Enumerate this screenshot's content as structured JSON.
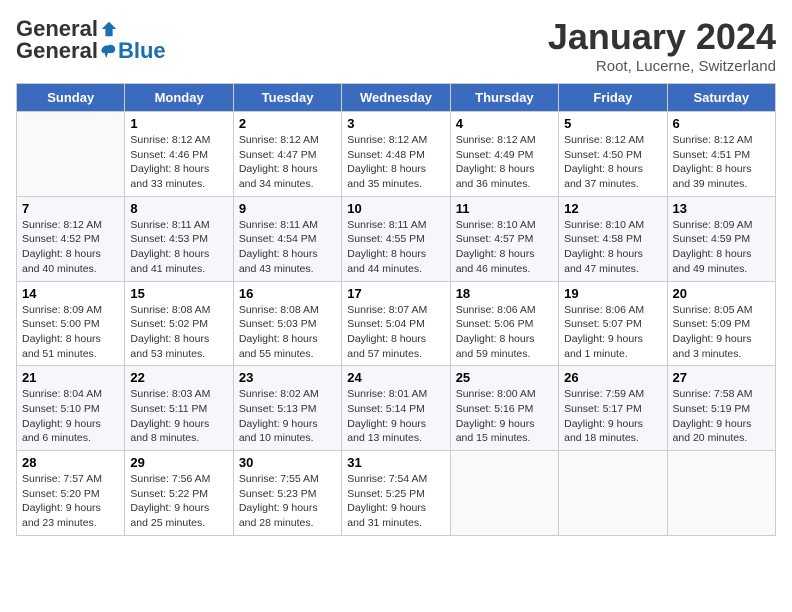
{
  "header": {
    "logo_general": "General",
    "logo_blue": "Blue",
    "title": "January 2024",
    "subtitle": "Root, Lucerne, Switzerland"
  },
  "days_of_week": [
    "Sunday",
    "Monday",
    "Tuesday",
    "Wednesday",
    "Thursday",
    "Friday",
    "Saturday"
  ],
  "weeks": [
    [
      {
        "num": "",
        "empty": true
      },
      {
        "num": "1",
        "sunrise": "Sunrise: 8:12 AM",
        "sunset": "Sunset: 4:46 PM",
        "daylight": "Daylight: 8 hours and 33 minutes."
      },
      {
        "num": "2",
        "sunrise": "Sunrise: 8:12 AM",
        "sunset": "Sunset: 4:47 PM",
        "daylight": "Daylight: 8 hours and 34 minutes."
      },
      {
        "num": "3",
        "sunrise": "Sunrise: 8:12 AM",
        "sunset": "Sunset: 4:48 PM",
        "daylight": "Daylight: 8 hours and 35 minutes."
      },
      {
        "num": "4",
        "sunrise": "Sunrise: 8:12 AM",
        "sunset": "Sunset: 4:49 PM",
        "daylight": "Daylight: 8 hours and 36 minutes."
      },
      {
        "num": "5",
        "sunrise": "Sunrise: 8:12 AM",
        "sunset": "Sunset: 4:50 PM",
        "daylight": "Daylight: 8 hours and 37 minutes."
      },
      {
        "num": "6",
        "sunrise": "Sunrise: 8:12 AM",
        "sunset": "Sunset: 4:51 PM",
        "daylight": "Daylight: 8 hours and 39 minutes."
      }
    ],
    [
      {
        "num": "7",
        "sunrise": "Sunrise: 8:12 AM",
        "sunset": "Sunset: 4:52 PM",
        "daylight": "Daylight: 8 hours and 40 minutes."
      },
      {
        "num": "8",
        "sunrise": "Sunrise: 8:11 AM",
        "sunset": "Sunset: 4:53 PM",
        "daylight": "Daylight: 8 hours and 41 minutes."
      },
      {
        "num": "9",
        "sunrise": "Sunrise: 8:11 AM",
        "sunset": "Sunset: 4:54 PM",
        "daylight": "Daylight: 8 hours and 43 minutes."
      },
      {
        "num": "10",
        "sunrise": "Sunrise: 8:11 AM",
        "sunset": "Sunset: 4:55 PM",
        "daylight": "Daylight: 8 hours and 44 minutes."
      },
      {
        "num": "11",
        "sunrise": "Sunrise: 8:10 AM",
        "sunset": "Sunset: 4:57 PM",
        "daylight": "Daylight: 8 hours and 46 minutes."
      },
      {
        "num": "12",
        "sunrise": "Sunrise: 8:10 AM",
        "sunset": "Sunset: 4:58 PM",
        "daylight": "Daylight: 8 hours and 47 minutes."
      },
      {
        "num": "13",
        "sunrise": "Sunrise: 8:09 AM",
        "sunset": "Sunset: 4:59 PM",
        "daylight": "Daylight: 8 hours and 49 minutes."
      }
    ],
    [
      {
        "num": "14",
        "sunrise": "Sunrise: 8:09 AM",
        "sunset": "Sunset: 5:00 PM",
        "daylight": "Daylight: 8 hours and 51 minutes."
      },
      {
        "num": "15",
        "sunrise": "Sunrise: 8:08 AM",
        "sunset": "Sunset: 5:02 PM",
        "daylight": "Daylight: 8 hours and 53 minutes."
      },
      {
        "num": "16",
        "sunrise": "Sunrise: 8:08 AM",
        "sunset": "Sunset: 5:03 PM",
        "daylight": "Daylight: 8 hours and 55 minutes."
      },
      {
        "num": "17",
        "sunrise": "Sunrise: 8:07 AM",
        "sunset": "Sunset: 5:04 PM",
        "daylight": "Daylight: 8 hours and 57 minutes."
      },
      {
        "num": "18",
        "sunrise": "Sunrise: 8:06 AM",
        "sunset": "Sunset: 5:06 PM",
        "daylight": "Daylight: 8 hours and 59 minutes."
      },
      {
        "num": "19",
        "sunrise": "Sunrise: 8:06 AM",
        "sunset": "Sunset: 5:07 PM",
        "daylight": "Daylight: 9 hours and 1 minute."
      },
      {
        "num": "20",
        "sunrise": "Sunrise: 8:05 AM",
        "sunset": "Sunset: 5:09 PM",
        "daylight": "Daylight: 9 hours and 3 minutes."
      }
    ],
    [
      {
        "num": "21",
        "sunrise": "Sunrise: 8:04 AM",
        "sunset": "Sunset: 5:10 PM",
        "daylight": "Daylight: 9 hours and 6 minutes."
      },
      {
        "num": "22",
        "sunrise": "Sunrise: 8:03 AM",
        "sunset": "Sunset: 5:11 PM",
        "daylight": "Daylight: 9 hours and 8 minutes."
      },
      {
        "num": "23",
        "sunrise": "Sunrise: 8:02 AM",
        "sunset": "Sunset: 5:13 PM",
        "daylight": "Daylight: 9 hours and 10 minutes."
      },
      {
        "num": "24",
        "sunrise": "Sunrise: 8:01 AM",
        "sunset": "Sunset: 5:14 PM",
        "daylight": "Daylight: 9 hours and 13 minutes."
      },
      {
        "num": "25",
        "sunrise": "Sunrise: 8:00 AM",
        "sunset": "Sunset: 5:16 PM",
        "daylight": "Daylight: 9 hours and 15 minutes."
      },
      {
        "num": "26",
        "sunrise": "Sunrise: 7:59 AM",
        "sunset": "Sunset: 5:17 PM",
        "daylight": "Daylight: 9 hours and 18 minutes."
      },
      {
        "num": "27",
        "sunrise": "Sunrise: 7:58 AM",
        "sunset": "Sunset: 5:19 PM",
        "daylight": "Daylight: 9 hours and 20 minutes."
      }
    ],
    [
      {
        "num": "28",
        "sunrise": "Sunrise: 7:57 AM",
        "sunset": "Sunset: 5:20 PM",
        "daylight": "Daylight: 9 hours and 23 minutes."
      },
      {
        "num": "29",
        "sunrise": "Sunrise: 7:56 AM",
        "sunset": "Sunset: 5:22 PM",
        "daylight": "Daylight: 9 hours and 25 minutes."
      },
      {
        "num": "30",
        "sunrise": "Sunrise: 7:55 AM",
        "sunset": "Sunset: 5:23 PM",
        "daylight": "Daylight: 9 hours and 28 minutes."
      },
      {
        "num": "31",
        "sunrise": "Sunrise: 7:54 AM",
        "sunset": "Sunset: 5:25 PM",
        "daylight": "Daylight: 9 hours and 31 minutes."
      },
      {
        "num": "",
        "empty": true
      },
      {
        "num": "",
        "empty": true
      },
      {
        "num": "",
        "empty": true
      }
    ]
  ]
}
